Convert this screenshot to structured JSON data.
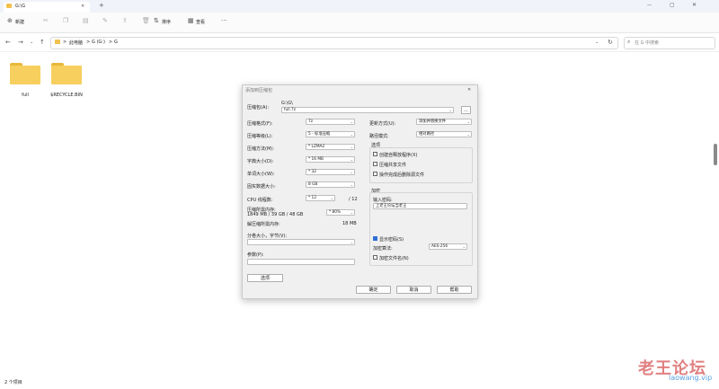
{
  "window": {
    "tab_title": "G:\\G",
    "new_tab": "+",
    "close": "✕",
    "minimize": "—",
    "maximize": "▢"
  },
  "toolbar": {
    "new_label": "新建",
    "sort_label": "排序",
    "view_label": "查看",
    "more": "···"
  },
  "address": {
    "crumbs": [
      "此电脑",
      "G (G:)",
      "G"
    ],
    "sep": ">",
    "search_placeholder": "在 G 中搜索"
  },
  "files": [
    {
      "name": "full"
    },
    {
      "name": "$RECYCLE.BIN"
    }
  ],
  "status": {
    "count": "2 个项目"
  },
  "dialog": {
    "title": "添加到压缩包",
    "archive_label": "压缩包(A):",
    "archive_path": "G:\\G\\",
    "archive_name": "full.7z",
    "browse": "...",
    "left": [
      {
        "label": "压缩格式(F):",
        "value": "7z"
      },
      {
        "label": "压缩等级(L):",
        "value": "5 - 标准压缩"
      },
      {
        "label": "压缩方法(M):",
        "value": "* LZMA2"
      },
      {
        "label": "字典大小(D):",
        "value": "* 16 MB"
      },
      {
        "label": "单词大小(W):",
        "value": "* 32"
      },
      {
        "label": "固实数据大小:",
        "value": "8 GB"
      }
    ],
    "cpu_label": "CPU 线程数:",
    "cpu_value": "* 12",
    "cpu_total": "/ 12",
    "mem_label": "压缩所需内存:",
    "mem_value": "1849 MB / 39 GB / 48 GB",
    "mem_pct": "* 80%",
    "decomp_label": "解压缩所需内存:",
    "decomp_value": "18 MB",
    "split_label": "分卷大小，字节(V):",
    "params_label": "参数(P):",
    "options_btn": "选项",
    "update_label": "更新方式(U):",
    "update_value": "添加并替换文件",
    "path_label": "路径模式:",
    "path_value": "相对路径",
    "opts_title": "选项",
    "opts": [
      {
        "label": "创建自释放程序(X)",
        "checked": false
      },
      {
        "label": "压缩共享文件",
        "checked": false
      },
      {
        "label": "操作完成后删除源文件",
        "checked": false
      }
    ],
    "enc_title": "加密",
    "pwd_label": "输入密码:",
    "pwd_value": "上老王论坛当老王",
    "show_pwd": "显示密码(S)",
    "enc_method_label": "加密算法:",
    "enc_method": "AES-256",
    "enc_names": "加密文件名(N)",
    "ok": "确定",
    "cancel": "取消",
    "help": "帮助"
  },
  "watermark": {
    "text": "老王论坛",
    "url": "laowang.vip"
  }
}
